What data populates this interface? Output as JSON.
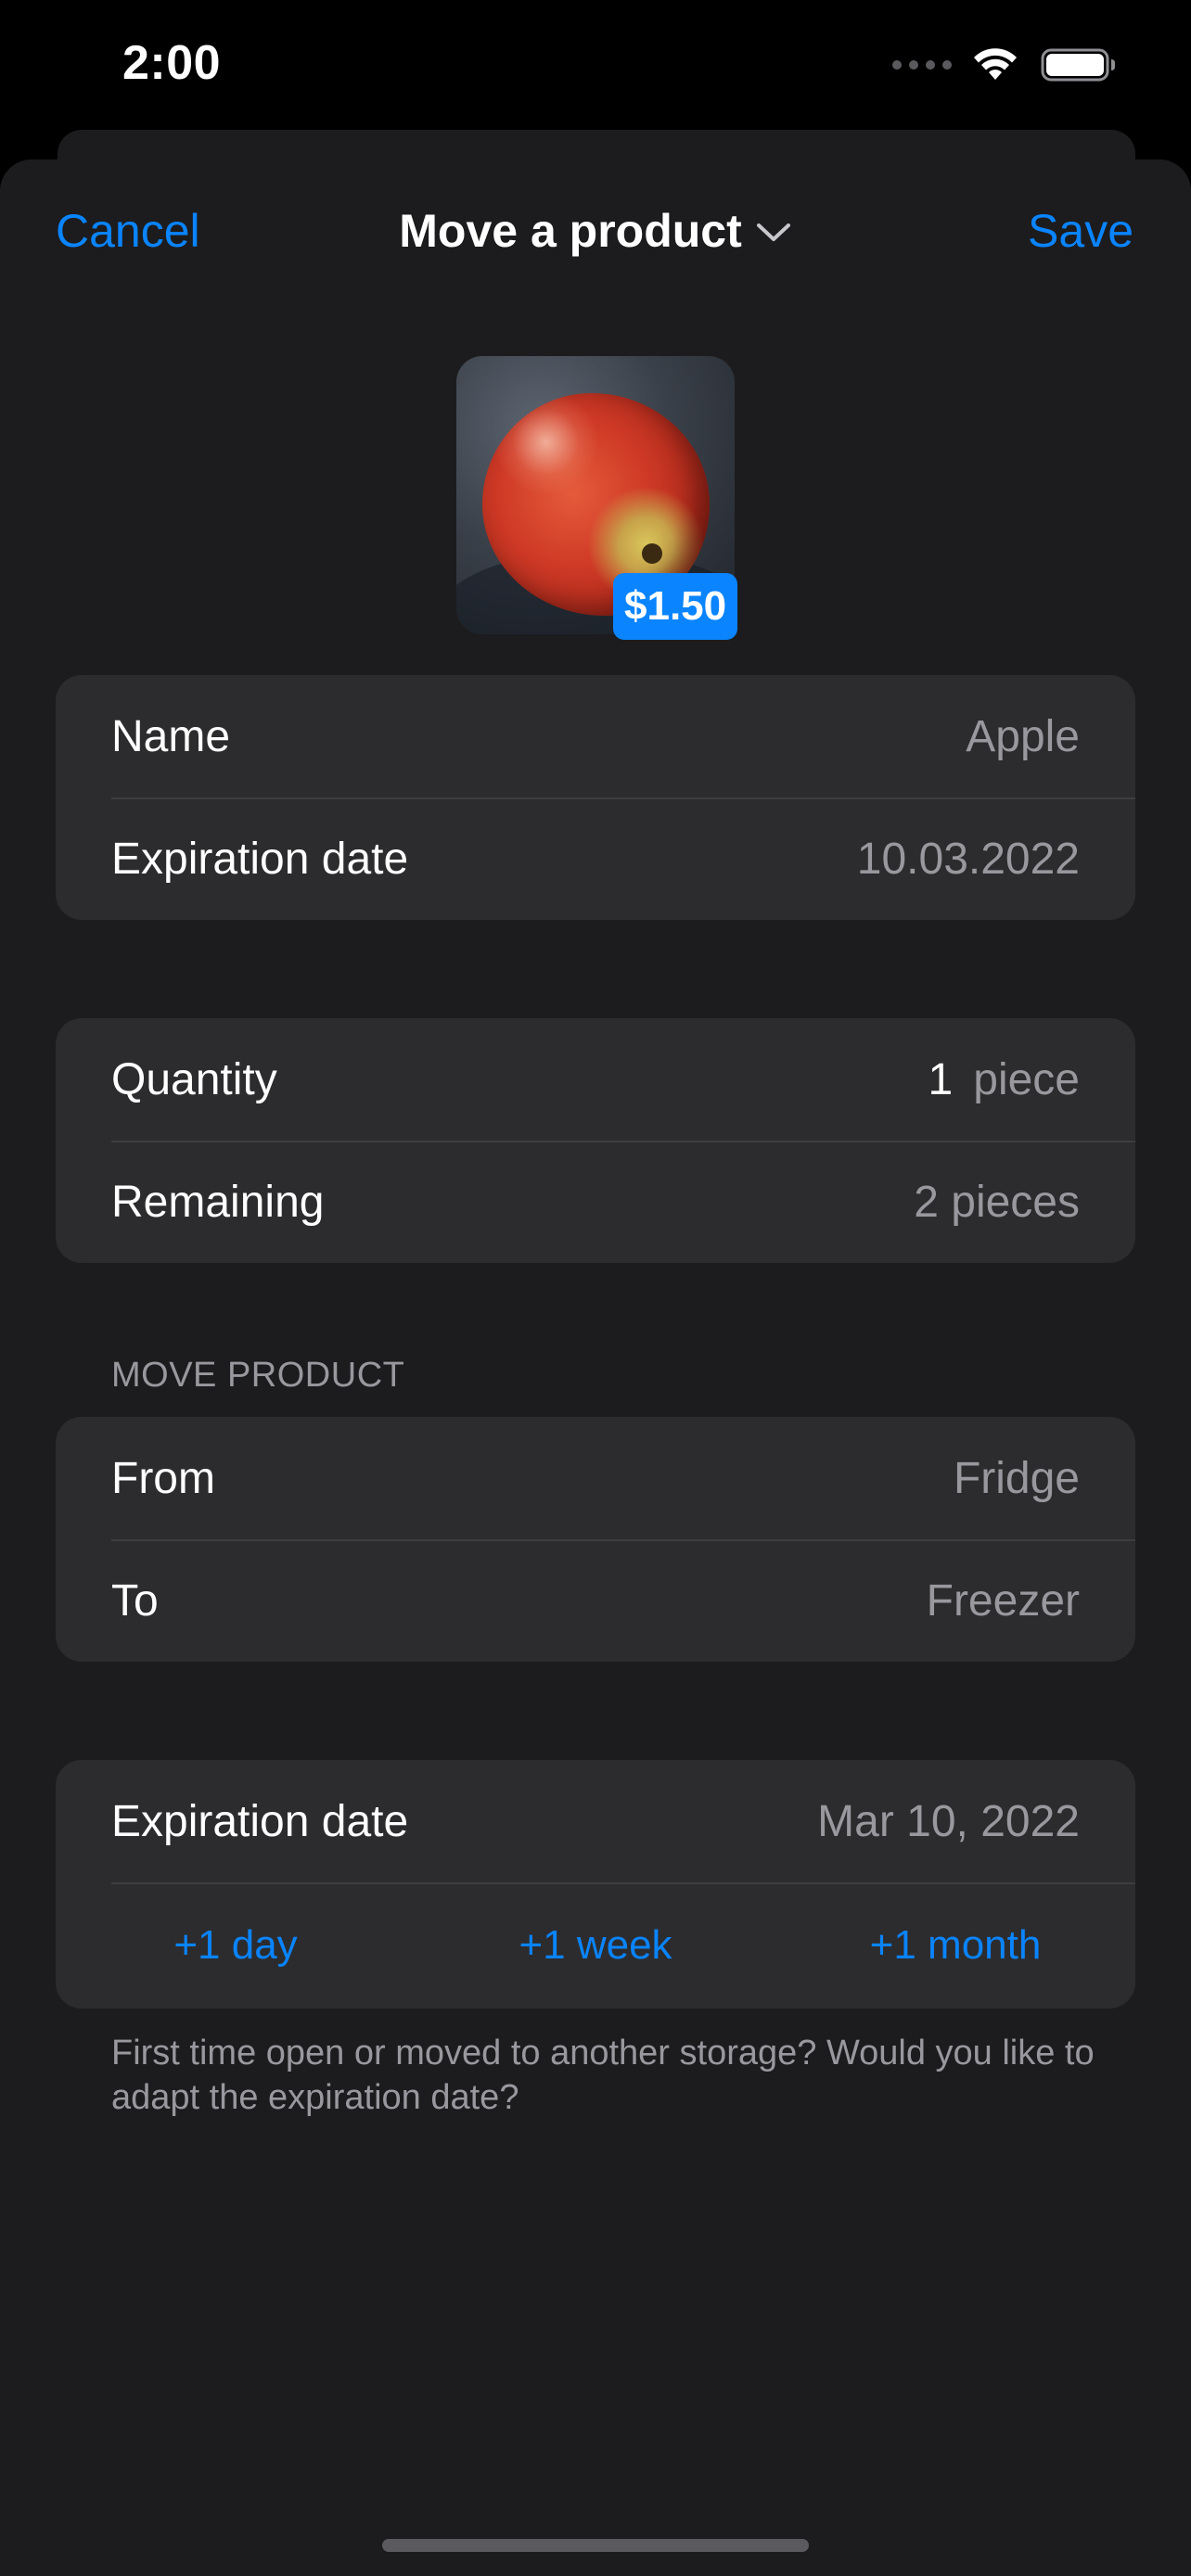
{
  "status_bar": {
    "time": "2:00"
  },
  "nav": {
    "cancel_label": "Cancel",
    "title": "Move a product",
    "save_label": "Save"
  },
  "product": {
    "image_icon": "apple-photo",
    "price": "$1.50"
  },
  "details": {
    "name_label": "Name",
    "name_value": "Apple",
    "expiration_label": "Expiration date",
    "expiration_value": "10.03.2022"
  },
  "quantity": {
    "quantity_label": "Quantity",
    "quantity_number": "1",
    "quantity_unit": "piece",
    "remaining_label": "Remaining",
    "remaining_value": "2 pieces"
  },
  "move": {
    "header": "MOVE PRODUCT",
    "from_label": "From",
    "from_value": "Fridge",
    "to_label": "To",
    "to_value": "Freezer"
  },
  "new_expiration": {
    "label": "Expiration date",
    "value": "Mar 10, 2022",
    "quick_buttons": [
      "+1 day",
      "+1 week",
      "+1 month"
    ],
    "note": "First time open or moved to another storage? Would you like to adapt the expiration date?"
  },
  "colors": {
    "accent": "#0a84ff",
    "sheet_background": "#1c1c1e",
    "group_background": "#2c2c2e",
    "secondary_text": "#98989e"
  }
}
